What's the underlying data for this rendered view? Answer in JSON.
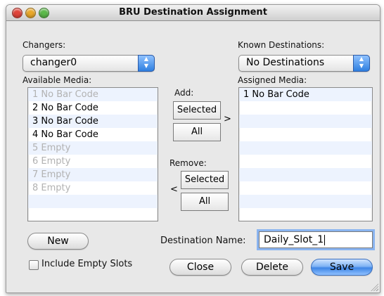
{
  "window": {
    "title": "BRU Destination Assignment"
  },
  "changers": {
    "label": "Changers:",
    "selected": "changer0"
  },
  "known_destinations": {
    "label": "Known Destinations:",
    "selected": "No Destinations"
  },
  "available_media": {
    "label": "Available Media:",
    "items": [
      {
        "text": "1 No Bar Code",
        "dim": true
      },
      {
        "text": "2 No Bar Code",
        "dim": false
      },
      {
        "text": "3 No Bar Code",
        "dim": false
      },
      {
        "text": "4 No Bar Code",
        "dim": false
      },
      {
        "text": "5 Empty",
        "dim": true
      },
      {
        "text": "6 Empty",
        "dim": true
      },
      {
        "text": "7 Empty",
        "dim": true
      },
      {
        "text": "8 Empty",
        "dim": true
      }
    ]
  },
  "assigned_media": {
    "label": "Assigned Media:",
    "items": [
      "1 No Bar Code"
    ]
  },
  "add": {
    "label": "Add:",
    "selected_label": "Selected",
    "all_label": "All",
    "arrow": ">"
  },
  "remove": {
    "label": "Remove:",
    "selected_label": "Selected",
    "all_label": "All",
    "arrow": "<"
  },
  "buttons": {
    "new": "New",
    "close": "Close",
    "delete": "Delete",
    "save": "Save"
  },
  "destination_name": {
    "label": "Destination Name:",
    "value": "Daily_Slot_1"
  },
  "include_empty_slots": {
    "label": "Include Empty Slots",
    "checked": false
  },
  "colors": {
    "close_button": "#e0443a",
    "minimize_button": "#e9a82a",
    "zoom_button": "#5cb94a",
    "stripe": "#edf3fe",
    "accent": "#3f86e6"
  }
}
